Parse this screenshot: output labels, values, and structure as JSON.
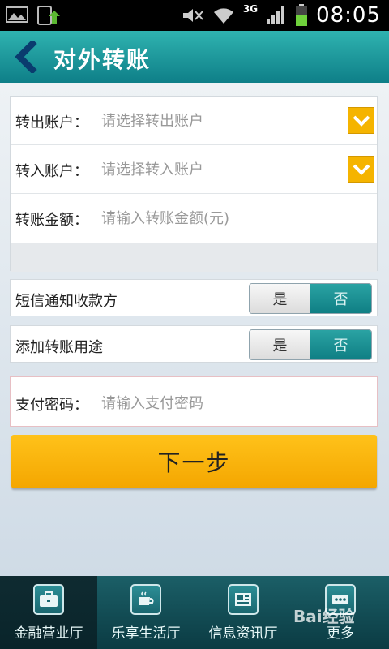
{
  "status_bar": {
    "time": "08:05",
    "network": "3G"
  },
  "header": {
    "title": "对外转账"
  },
  "form": {
    "from_account": {
      "label": "转出账户：",
      "placeholder": "请选择转出账户"
    },
    "to_account": {
      "label": "转入账户：",
      "placeholder": "请选择转入账户"
    },
    "amount": {
      "label": "转账金额：",
      "placeholder": "请输入转账金额(元)"
    }
  },
  "sms_notify": {
    "label": "短信通知收款方",
    "yes": "是",
    "no": "否",
    "selected": "否"
  },
  "purpose": {
    "label": "添加转账用途",
    "yes": "是",
    "no": "否",
    "selected": "否"
  },
  "password": {
    "label": "支付密码：",
    "placeholder": "请输入支付密码"
  },
  "next_button": {
    "label": "下一步"
  },
  "tabs": [
    {
      "label": "金融营业厅",
      "icon": "briefcase-icon",
      "active": true
    },
    {
      "label": "乐享生活厅",
      "icon": "coffee-cup-icon",
      "active": false
    },
    {
      "label": "信息资讯厅",
      "icon": "newspaper-icon",
      "active": false
    },
    {
      "label": "更多",
      "icon": "more-icon",
      "active": false
    }
  ],
  "watermark": "Bai经验",
  "colors": {
    "accent": "#0e7f88",
    "button": "#f5b400"
  }
}
